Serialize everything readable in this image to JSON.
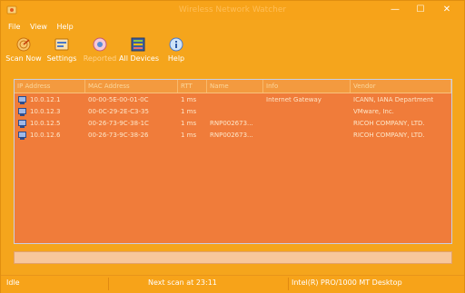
{
  "window": {
    "title": "Wireless Network Watcher",
    "minimize_glyph": "—",
    "maximize_glyph": "☐",
    "close_glyph": "✕"
  },
  "menu": {
    "items": [
      {
        "label": "File"
      },
      {
        "label": "View"
      },
      {
        "label": "Help"
      }
    ]
  },
  "toolbar": {
    "buttons": [
      {
        "label": "Scan Now",
        "icon": "radar-icon",
        "enabled": true
      },
      {
        "label": "Settings",
        "icon": "settings-icon",
        "enabled": true
      },
      {
        "label": "Reported",
        "icon": "report-icon",
        "enabled": false
      },
      {
        "label": "All Devices",
        "icon": "devices-icon",
        "enabled": true
      },
      {
        "label": "Help",
        "icon": "help-icon",
        "enabled": true
      }
    ]
  },
  "device_list": {
    "columns": [
      "IP Address",
      "MAC Address",
      "RTT",
      "Name",
      "Info",
      "Vendor"
    ],
    "rows": [
      [
        "10.0.12.1",
        "00-00-5E-00-01-0C",
        "1 ms",
        "",
        "Internet Gateway",
        "ICANN, IANA Department"
      ],
      [
        "10.0.12.3",
        "00-0C-29-2E-C3-35",
        "1 ms",
        "",
        "",
        "VMware, Inc."
      ],
      [
        "10.0.12.5",
        "00-26-73-9C-38-1C",
        "1 ms",
        "RNP002673...",
        "",
        "RICOH COMPANY, LTD."
      ],
      [
        "10.0.12.6",
        "00-26-73-9C-38-26",
        "1 ms",
        "RNP002673...",
        "",
        "RICOH COMPANY, LTD."
      ]
    ]
  },
  "statusbar": {
    "state": "Idle",
    "next_scan": "Next scan at 23:11",
    "adapter": "Intel(R) PRO/1000 MT Desktop"
  },
  "colors": {
    "frame": "#f5a51c",
    "list_background": "#f07c3a",
    "list_header": "#f39a3f"
  }
}
